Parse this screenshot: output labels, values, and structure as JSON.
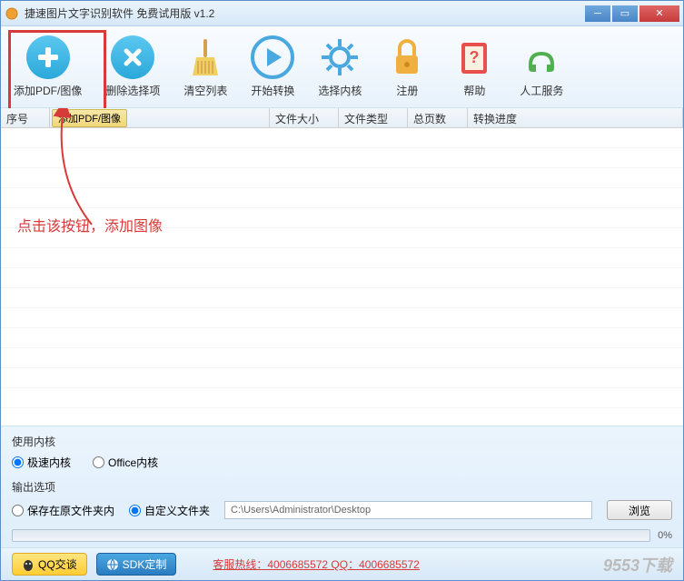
{
  "titlebar": {
    "title": "捷速图片文字识别软件 免费试用版 v1.2"
  },
  "toolbar": {
    "add": "添加PDF/图像",
    "delete": "删除选择项",
    "clear": "清空列表",
    "start": "开始转换",
    "engine": "选择内核",
    "register": "注册",
    "help": "帮助",
    "service": "人工服务"
  },
  "table": {
    "headers": {
      "seq": "序号",
      "addfile_btn": "添加PDF/图像",
      "size": "文件大小",
      "type": "文件类型",
      "pages": "总页数",
      "progress": "转换进度"
    }
  },
  "annotation": {
    "text": "点击该按钮，添加图像"
  },
  "engine_section": {
    "label": "使用内核",
    "opt_fast": "极速内核",
    "opt_office": "Office内核"
  },
  "output_section": {
    "label": "输出选项",
    "opt_same": "保存在原文件夹内",
    "opt_custom": "自定义文件夹",
    "path": "C:\\Users\\Administrator\\Desktop",
    "browse": "浏览"
  },
  "progress": {
    "pct": "0%"
  },
  "footer": {
    "qq": "QQ交谈",
    "sdk": "SDK定制",
    "hotline": "客服热线：4006685572 QQ：4006685572",
    "watermark": "9553下载"
  }
}
